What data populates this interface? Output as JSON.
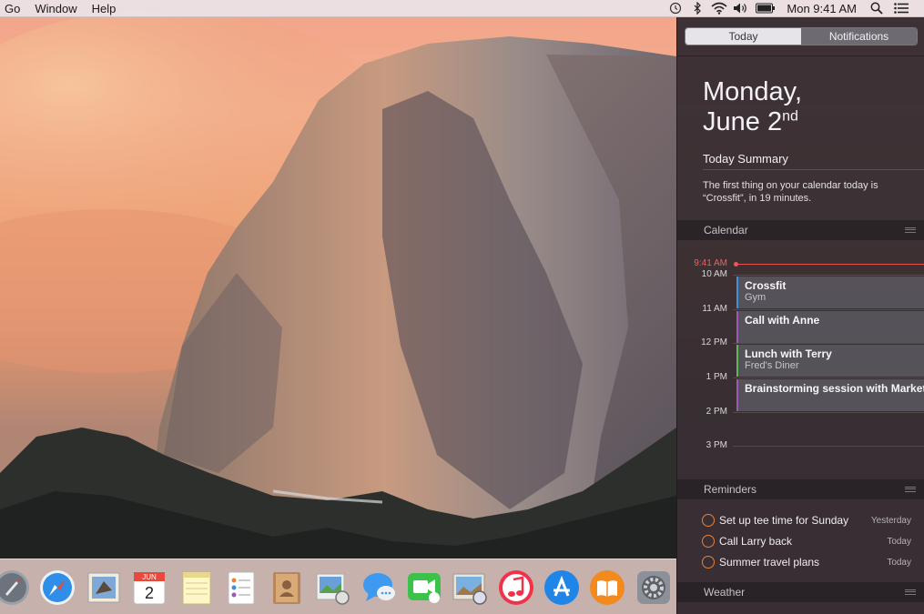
{
  "menubar": {
    "items": [
      "Go",
      "Window",
      "Help"
    ],
    "clock": "Mon 9:41 AM",
    "status_icons": [
      "time-machine-icon",
      "bluetooth-icon",
      "wifi-icon",
      "volume-icon",
      "battery-icon",
      "spotlight-icon",
      "notification-center-icon"
    ]
  },
  "notification_center": {
    "tabs": {
      "today": "Today",
      "notifications": "Notifications"
    },
    "active_tab": "Today",
    "date_line1": "Monday,",
    "date_line2": "June 2",
    "date_suffix": "nd",
    "summary_title": "Today Summary",
    "summary_text": "The first thing on your calendar today is “Crossfit”, in 19 minutes.",
    "calendar": {
      "header": "Calendar",
      "now_label": "9:41 AM",
      "hours": [
        "10 AM",
        "11 AM",
        "12 PM",
        "1 PM",
        "2 PM",
        "3 PM"
      ],
      "events": [
        {
          "title": "Crossfit",
          "subtitle": "Gym",
          "color": "#3d8fd6"
        },
        {
          "title": "Call with Anne",
          "subtitle": "",
          "color": "#9b59b6"
        },
        {
          "title": "Lunch with Terry",
          "subtitle": "Fred's Diner",
          "color": "#5cb85c"
        },
        {
          "title": "Brainstorming session with Marketing",
          "subtitle": "",
          "color": "#9b59b6"
        }
      ]
    },
    "reminders": {
      "header": "Reminders",
      "items": [
        {
          "text": "Set up tee time for Sunday",
          "date": "Yesterday"
        },
        {
          "text": "Call Larry back",
          "date": "Today"
        },
        {
          "text": "Summer travel plans",
          "date": "Today"
        }
      ]
    },
    "weather": {
      "header": "Weather"
    }
  },
  "dock": {
    "apps": [
      "launchpad-icon",
      "safari-icon",
      "mail-icon",
      "calendar-icon",
      "notes-icon",
      "reminders-icon",
      "contacts-icon",
      "preview-icon",
      "messages-icon",
      "facetime-icon",
      "iphoto-icon",
      "itunes-icon",
      "app-store-icon",
      "ibooks-icon",
      "system-preferences-icon"
    ],
    "calendar_month": "JUN",
    "calendar_day": "2"
  },
  "colors": {
    "accent_red": "#e85050",
    "reminder_orange": "#e8823a",
    "segment_active": "#e6e4e8"
  }
}
